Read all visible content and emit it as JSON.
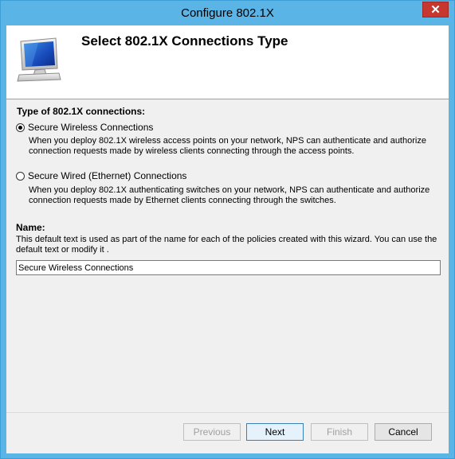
{
  "window": {
    "title": "Configure 802.1X",
    "close_glyph": "✕"
  },
  "header": {
    "title": "Select 802.1X Connections Type",
    "icon": "monitor-icon"
  },
  "connections": {
    "label": "Type of 802.1X connections:",
    "options": [
      {
        "label": "Secure Wireless Connections",
        "checked": true,
        "description": "When you deploy 802.1X wireless access points on your network, NPS can authenticate and authorize connection requests made by wireless clients connecting through the access points."
      },
      {
        "label": "Secure Wired (Ethernet) Connections",
        "checked": false,
        "description": "When you deploy 802.1X authenticating switches on your network, NPS can authenticate and authorize connection requests made by Ethernet clients connecting through the switches."
      }
    ]
  },
  "name": {
    "label": "Name:",
    "description": "This default text is used as part of the name for each of the policies created with this wizard. You can use the default text or modify it .",
    "value": "Secure Wireless Connections"
  },
  "buttons": {
    "previous": "Previous",
    "next": "Next",
    "finish": "Finish",
    "cancel": "Cancel"
  },
  "colors": {
    "titlebar": "#5bb4e6",
    "close": "#c7362f"
  }
}
